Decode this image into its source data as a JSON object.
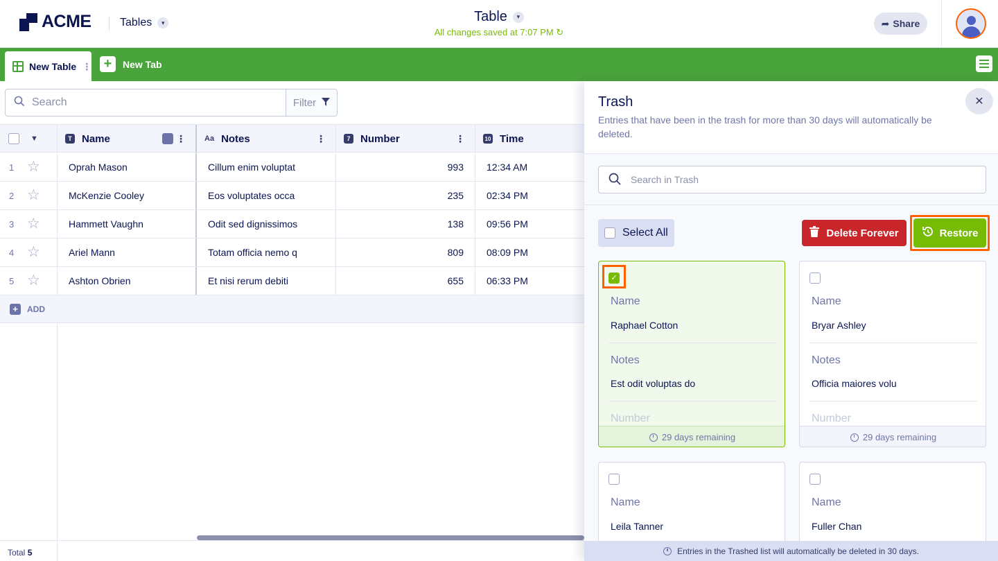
{
  "header": {
    "logo_text": "ACME",
    "nav_dropdown": "Tables",
    "title": "Table",
    "saved_status": "All changes saved at 7:07 PM",
    "share_label": "Share"
  },
  "tabs": {
    "active_tab": "New Table",
    "new_tab_label": "New Tab"
  },
  "toolbar": {
    "search_placeholder": "Search",
    "filter_label": "Filter"
  },
  "table": {
    "columns": [
      {
        "label": "Name",
        "icon": "text-type-icon"
      },
      {
        "label": "Notes",
        "icon": "long-text-type-icon"
      },
      {
        "label": "Number",
        "icon": "number-type-icon"
      },
      {
        "label": "Time",
        "icon": "calendar-type-icon"
      }
    ],
    "rows": [
      {
        "num": "1",
        "name": "Oprah Mason",
        "notes": "Cillum enim voluptat",
        "number": "993",
        "time": "12:34 AM"
      },
      {
        "num": "2",
        "name": "McKenzie Cooley",
        "notes": "Eos voluptates occa",
        "number": "235",
        "time": "02:34 PM"
      },
      {
        "num": "3",
        "name": "Hammett Vaughn",
        "notes": "Odit sed dignissimos",
        "number": "138",
        "time": "09:56 PM"
      },
      {
        "num": "4",
        "name": "Ariel Mann",
        "notes": "Totam officia nemo q",
        "number": "809",
        "time": "08:09 PM"
      },
      {
        "num": "5",
        "name": "Ashton Obrien",
        "notes": "Et nisi rerum debiti",
        "number": "655",
        "time": "06:33 PM"
      }
    ],
    "add_label": "ADD",
    "total_label": "Total",
    "total_count": "5"
  },
  "trash": {
    "title": "Trash",
    "description": "Entries that have been in the trash for more than 30 days will automatically be deleted.",
    "search_placeholder": "Search in Trash",
    "select_all_label": "Select All",
    "delete_label": "Delete Forever",
    "restore_label": "Restore",
    "cards": [
      {
        "name_label": "Name",
        "name": "Raphael Cotton",
        "notes_label": "Notes",
        "notes": "Est odit voluptas do",
        "number_label": "Number",
        "remaining": "29 days remaining",
        "selected": true
      },
      {
        "name_label": "Name",
        "name": "Bryar Ashley",
        "notes_label": "Notes",
        "notes": "Officia maiores volu",
        "number_label": "Number",
        "remaining": "29 days remaining",
        "selected": false
      },
      {
        "name_label": "Name",
        "name": "Leila Tanner",
        "selected": false
      },
      {
        "name_label": "Name",
        "name": "Fuller Chan",
        "selected": false
      }
    ],
    "footer_note": "Entries in the Trashed list will automatically be deleted in 30 days."
  },
  "colors": {
    "brand_navy": "#0a1551",
    "tab_green": "#4aa43c",
    "restore_green": "#78bb07",
    "delete_red": "#c8262b",
    "highlight_orange": "#ff6100"
  }
}
